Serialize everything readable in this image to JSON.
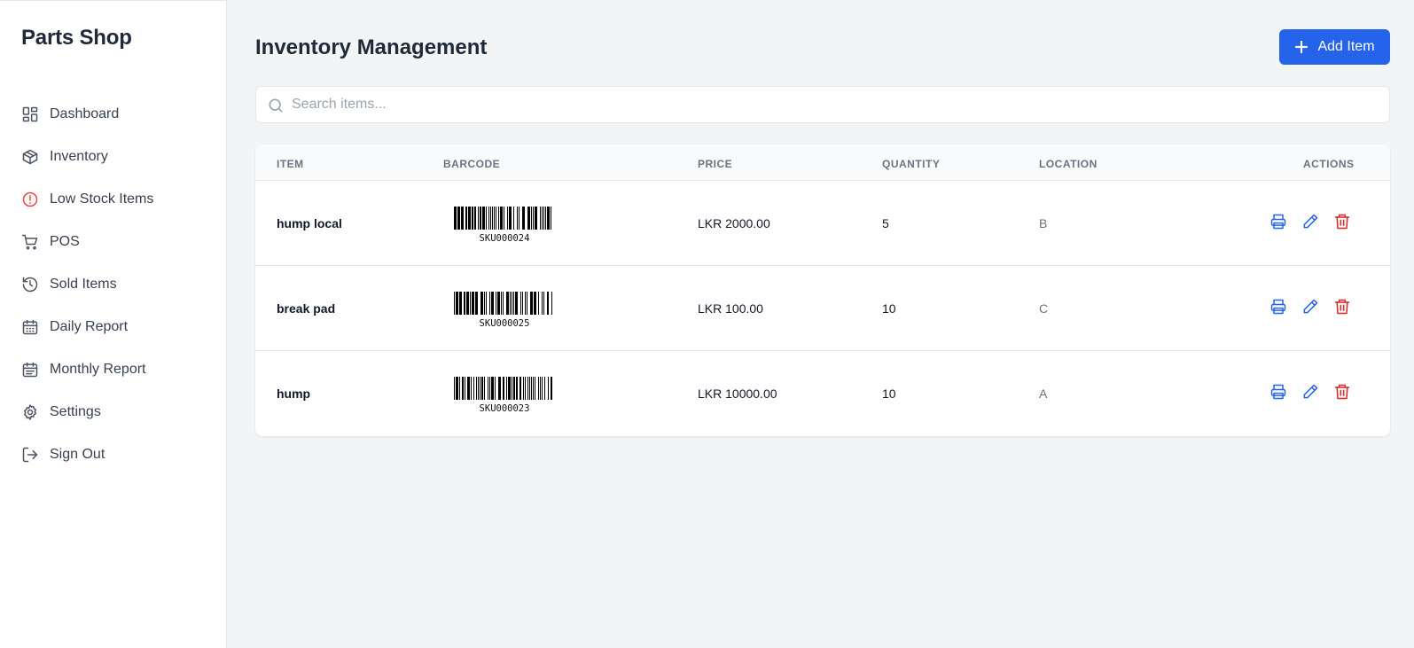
{
  "sidebar": {
    "brand": "Parts Shop",
    "items": [
      {
        "label": "Dashboard",
        "icon": "dashboard-icon"
      },
      {
        "label": "Inventory",
        "icon": "box-icon"
      },
      {
        "label": "Low Stock Items",
        "icon": "alert-circle-icon"
      },
      {
        "label": "POS",
        "icon": "cart-icon"
      },
      {
        "label": "Sold Items",
        "icon": "history-icon"
      },
      {
        "label": "Daily Report",
        "icon": "calendar-icon"
      },
      {
        "label": "Monthly Report",
        "icon": "calendar-icon"
      },
      {
        "label": "Settings",
        "icon": "gear-icon"
      },
      {
        "label": "Sign Out",
        "icon": "sign-out-icon"
      }
    ]
  },
  "header": {
    "title": "Inventory Management",
    "add_label": "Add Item"
  },
  "search": {
    "placeholder": "Search items...",
    "value": ""
  },
  "table": {
    "columns": [
      "ITEM",
      "BARCODE",
      "PRICE",
      "QUANTITY",
      "LOCATION",
      "ACTIONS"
    ],
    "rows": [
      {
        "item": "hump local",
        "barcode": "SKU000024",
        "price": "LKR 2000.00",
        "quantity": "5",
        "location": "B"
      },
      {
        "item": "break pad",
        "barcode": "SKU000025",
        "price": "LKR 100.00",
        "quantity": "10",
        "location": "C"
      },
      {
        "item": "hump",
        "barcode": "SKU000023",
        "price": "LKR 10000.00",
        "quantity": "10",
        "location": "A"
      }
    ]
  },
  "colors": {
    "primary": "#2563eb",
    "danger": "#dc2626",
    "alert": "#ef4444",
    "background": "#f3f4f6"
  }
}
